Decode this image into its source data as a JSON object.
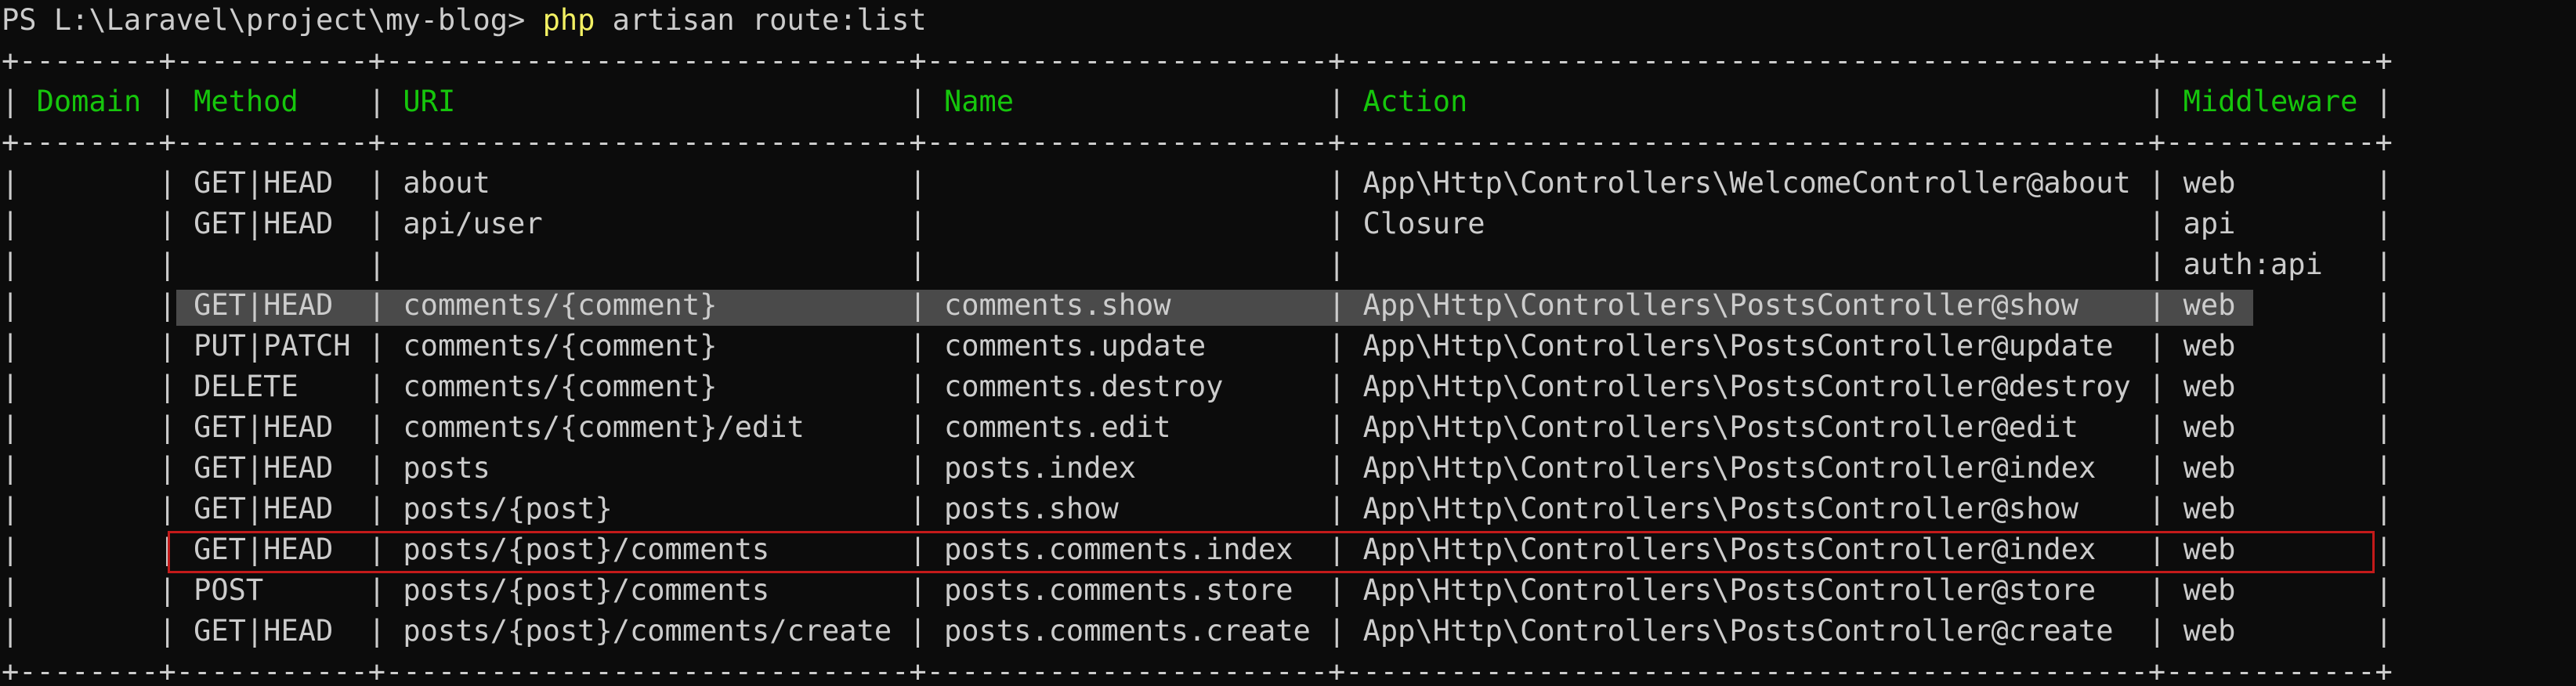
{
  "terminal": {
    "prompt": "PS L:\\Laravel\\project\\my-blog> ",
    "command_bin": "php",
    "command_args": " artisan route:list"
  },
  "table": {
    "headers": [
      "Domain",
      "Method",
      "URI",
      "Name",
      "Action",
      "Middleware"
    ],
    "rows": [
      [
        "",
        "GET|HEAD",
        "about",
        "",
        "App\\Http\\Controllers\\WelcomeController@about",
        "web"
      ],
      [
        "",
        "GET|HEAD",
        "api/user",
        "",
        "Closure",
        "api"
      ],
      [
        "",
        "",
        "",
        "",
        "",
        "auth:api"
      ],
      [
        "",
        "GET|HEAD",
        "comments/{comment}",
        "comments.show",
        "App\\Http\\Controllers\\PostsController@show",
        "web"
      ],
      [
        "",
        "PUT|PATCH",
        "comments/{comment}",
        "comments.update",
        "App\\Http\\Controllers\\PostsController@update",
        "web"
      ],
      [
        "",
        "DELETE",
        "comments/{comment}",
        "comments.destroy",
        "App\\Http\\Controllers\\PostsController@destroy",
        "web"
      ],
      [
        "",
        "GET|HEAD",
        "comments/{comment}/edit",
        "comments.edit",
        "App\\Http\\Controllers\\PostsController@edit",
        "web"
      ],
      [
        "",
        "GET|HEAD",
        "posts",
        "posts.index",
        "App\\Http\\Controllers\\PostsController@index",
        "web"
      ],
      [
        "",
        "GET|HEAD",
        "posts/{post}",
        "posts.show",
        "App\\Http\\Controllers\\PostsController@show",
        "web"
      ],
      [
        "",
        "GET|HEAD",
        "posts/{post}/comments",
        "posts.comments.index",
        "App\\Http\\Controllers\\PostsController@index",
        "web"
      ],
      [
        "",
        "POST",
        "posts/{post}/comments",
        "posts.comments.store",
        "App\\Http\\Controllers\\PostsController@store",
        "web"
      ],
      [
        "",
        "GET|HEAD",
        "posts/{post}/comments/create",
        "posts.comments.create",
        "App\\Http\\Controllers\\PostsController@create",
        "web"
      ]
    ]
  },
  "colors": {
    "background": "#0c0c0c",
    "text": "#cccccc",
    "header": "#16c60c",
    "command": "#f3f163",
    "highlight": "#4a4a4a",
    "selection_border": "#c41a1a"
  }
}
